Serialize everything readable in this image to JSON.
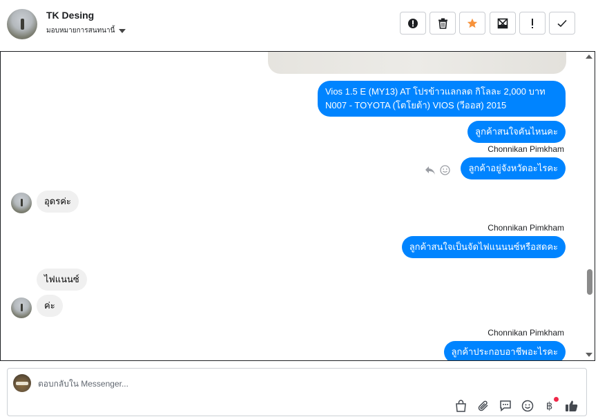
{
  "header": {
    "title": "TK Desing",
    "subtitle": "มอบหมายการสนทนานี้",
    "buttons": [
      {
        "name": "spam",
        "icon": "alert-circle-icon"
      },
      {
        "name": "delete",
        "icon": "trash-icon"
      },
      {
        "name": "star",
        "icon": "star-icon",
        "color": "#f7923b"
      },
      {
        "name": "mark-unread",
        "icon": "envelope-x-icon"
      },
      {
        "name": "follow-up",
        "icon": "exclamation-icon"
      },
      {
        "name": "done",
        "icon": "check-icon"
      }
    ]
  },
  "messages": {
    "m1": "Vios 1.5 E (MY13) AT โปรข้าวแลกลด กิโลละ 2,000 บาท",
    "m1_line2": "N007 - TOYOTA (โตโยต้า) VIOS (วีออส) 2015",
    "m2": "ลูกค้าสนใจคันไหนคะ",
    "sender1": "Chonnikan Pimkham",
    "m3": "ลูกค้าอยู่จังหวัดอะไรคะ",
    "in1": "อุดรค่ะ",
    "sender2": "Chonnikan Pimkham",
    "m4": "ลูกค้าสนใจเป็นจัดไฟแนนนซ์หรือสดคะ",
    "in2": "ไฟแนนซ์",
    "in3": "ค่ะ",
    "sender3": "Chonnikan Pimkham",
    "m5": "ลูกค้าประกอบอาชีพอะไรคะ"
  },
  "composer": {
    "placeholder": "ตอบกลับใน Messenger...",
    "tools": [
      "bag-icon",
      "paperclip-icon",
      "saved-reply-icon",
      "emoji-icon",
      "baht-icon",
      "thumbs-up-icon"
    ],
    "baht_symbol": "฿",
    "accent": "#0084ff"
  }
}
